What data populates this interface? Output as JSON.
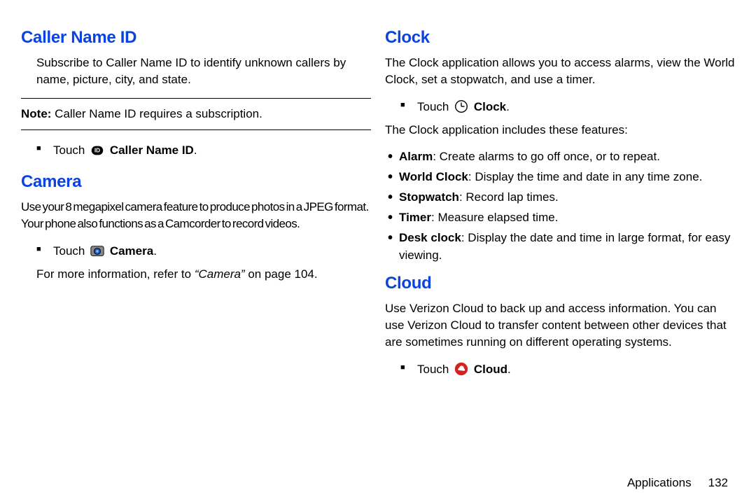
{
  "left": {
    "caller": {
      "heading": "Caller Name ID",
      "para": "Subscribe to Caller Name ID to identify unknown callers by name, picture, city, and state.",
      "note_label": "Note:",
      "note_text": " Caller Name ID requires a subscription.",
      "touch_prefix": "Touch ",
      "touch_bold": "Caller Name ID",
      "touch_suffix": "."
    },
    "camera": {
      "heading": "Camera",
      "para": "Use your 8 megapixel camera feature to produce photos in a JPEG format. Your phone also functions as a Camcorder to record videos.",
      "touch_prefix": "Touch ",
      "touch_bold": "Camera",
      "touch_suffix": ".",
      "refer_pre": "For more information, refer to ",
      "refer_italic": "“Camera”",
      "refer_post": " on page 104."
    }
  },
  "right": {
    "clock": {
      "heading": "Clock",
      "para": "The Clock application allows you to access alarms, view the World Clock, set a stopwatch, and use a timer.",
      "touch_prefix": "Touch ",
      "touch_bold": "Clock",
      "touch_suffix": ".",
      "features_intro": "The Clock application includes these features:",
      "items": [
        {
          "name": "Alarm",
          "desc": ": Create alarms to go off once, or to repeat."
        },
        {
          "name": "World Clock",
          "desc": ": Display the time and date in any time zone."
        },
        {
          "name": "Stopwatch",
          "desc": ": Record lap times."
        },
        {
          "name": "Timer",
          "desc": ": Measure elapsed time."
        },
        {
          "name": "Desk clock",
          "desc": ": Display the date and time in large format, for easy viewing."
        }
      ]
    },
    "cloud": {
      "heading": "Cloud",
      "para": "Use Verizon Cloud to back up and access information. You can use Verizon Cloud to transfer content between other devices that are sometimes running on different operating systems.",
      "touch_prefix": "Touch ",
      "touch_bold": "Cloud",
      "touch_suffix": "."
    }
  },
  "footer": {
    "section": "Applications",
    "page": "132"
  }
}
